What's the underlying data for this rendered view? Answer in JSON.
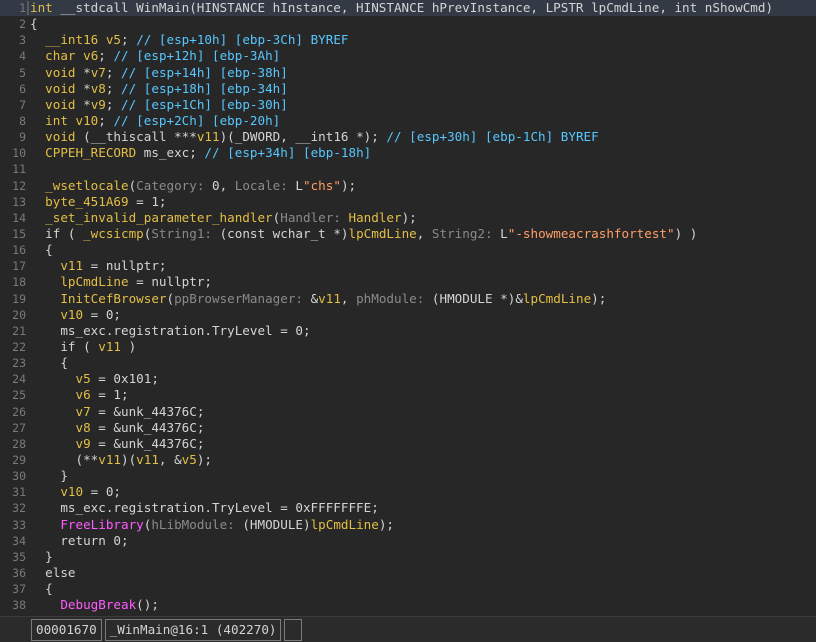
{
  "code_lines": [
    {
      "num": "1",
      "segs": [
        [
          "tp",
          "int"
        ],
        [
          "pl",
          " __stdcall WinMain(HINSTANCE hInstance, HINSTANCE hPrevInstance, LPSTR lpCmdLine, int nShowCmd)"
        ]
      ],
      "active": true
    },
    {
      "num": "2",
      "segs": [
        [
          "pl",
          "{"
        ]
      ]
    },
    {
      "num": "3",
      "segs": [
        [
          "pl",
          "  "
        ],
        [
          "tp",
          "__int16"
        ],
        [
          "pl",
          " "
        ],
        [
          "lv",
          "v5"
        ],
        [
          "pl",
          "; "
        ],
        [
          "cm",
          "// [esp+10h] [ebp-3Ch] BYREF"
        ]
      ]
    },
    {
      "num": "4",
      "segs": [
        [
          "pl",
          "  "
        ],
        [
          "tp",
          "char"
        ],
        [
          "pl",
          " "
        ],
        [
          "lv",
          "v6"
        ],
        [
          "pl",
          "; "
        ],
        [
          "cm",
          "// [esp+12h] [ebp-3Ah]"
        ]
      ]
    },
    {
      "num": "5",
      "segs": [
        [
          "pl",
          "  "
        ],
        [
          "tp",
          "void"
        ],
        [
          "pl",
          " *"
        ],
        [
          "lv",
          "v7"
        ],
        [
          "pl",
          "; "
        ],
        [
          "cm",
          "// [esp+14h] [ebp-38h]"
        ]
      ]
    },
    {
      "num": "6",
      "segs": [
        [
          "pl",
          "  "
        ],
        [
          "tp",
          "void"
        ],
        [
          "pl",
          " *"
        ],
        [
          "lv",
          "v8"
        ],
        [
          "pl",
          "; "
        ],
        [
          "cm",
          "// [esp+18h] [ebp-34h]"
        ]
      ]
    },
    {
      "num": "7",
      "segs": [
        [
          "pl",
          "  "
        ],
        [
          "tp",
          "void"
        ],
        [
          "pl",
          " *"
        ],
        [
          "lv",
          "v9"
        ],
        [
          "pl",
          "; "
        ],
        [
          "cm",
          "// [esp+1Ch] [ebp-30h]"
        ]
      ]
    },
    {
      "num": "8",
      "segs": [
        [
          "pl",
          "  "
        ],
        [
          "tp",
          "int"
        ],
        [
          "pl",
          " "
        ],
        [
          "lv",
          "v10"
        ],
        [
          "pl",
          "; "
        ],
        [
          "cm",
          "// [esp+2Ch] [ebp-20h]"
        ]
      ]
    },
    {
      "num": "9",
      "segs": [
        [
          "pl",
          "  "
        ],
        [
          "tp",
          "void"
        ],
        [
          "pl",
          " (__thiscall ***"
        ],
        [
          "lv",
          "v11"
        ],
        [
          "pl",
          ")(_DWORD, __int16 *); "
        ],
        [
          "cm",
          "// [esp+30h] [ebp-1Ch] BYREF"
        ]
      ]
    },
    {
      "num": "10",
      "segs": [
        [
          "pl",
          "  "
        ],
        [
          "tp",
          "CPPEH_RECORD"
        ],
        [
          "pl",
          " ms_exc; "
        ],
        [
          "cm",
          "// [esp+34h] [ebp-18h]"
        ]
      ]
    },
    {
      "num": "11",
      "segs": []
    },
    {
      "num": "12",
      "segs": [
        [
          "pl",
          "  "
        ],
        [
          "fn",
          "_wsetlocale"
        ],
        [
          "pl",
          "("
        ],
        [
          "hn",
          "Category: "
        ],
        [
          "pl",
          "0, "
        ],
        [
          "hn",
          "Locale: "
        ],
        [
          "pl",
          "L"
        ],
        [
          "st",
          "\"chs\""
        ],
        [
          "pl",
          ");"
        ]
      ]
    },
    {
      "num": "13",
      "segs": [
        [
          "pl",
          "  "
        ],
        [
          "gv",
          "byte_451A69"
        ],
        [
          "pl",
          " = 1;"
        ]
      ]
    },
    {
      "num": "14",
      "segs": [
        [
          "pl",
          "  "
        ],
        [
          "fn",
          "_set_invalid_parameter_handler"
        ],
        [
          "pl",
          "("
        ],
        [
          "hn",
          "Handler: "
        ],
        [
          "fn",
          "Handler"
        ],
        [
          "pl",
          ");"
        ]
      ]
    },
    {
      "num": "15",
      "segs": [
        [
          "pl",
          "  if ( "
        ],
        [
          "fn",
          "_wcsicmp"
        ],
        [
          "pl",
          "("
        ],
        [
          "hn",
          "String1: "
        ],
        [
          "pl",
          "(const wchar_t *)"
        ],
        [
          "lv",
          "lpCmdLine"
        ],
        [
          "pl",
          ", "
        ],
        [
          "hn",
          "String2: "
        ],
        [
          "pl",
          "L"
        ],
        [
          "st",
          "\"-showmeacrashfortest\""
        ],
        [
          "pl",
          ") )"
        ]
      ]
    },
    {
      "num": "16",
      "segs": [
        [
          "pl",
          "  {"
        ]
      ]
    },
    {
      "num": "17",
      "segs": [
        [
          "pl",
          "    "
        ],
        [
          "lv",
          "v11"
        ],
        [
          "pl",
          " = nullptr;"
        ]
      ]
    },
    {
      "num": "18",
      "segs": [
        [
          "pl",
          "    "
        ],
        [
          "lv",
          "lpCmdLine"
        ],
        [
          "pl",
          " = nullptr;"
        ]
      ]
    },
    {
      "num": "19",
      "segs": [
        [
          "pl",
          "    "
        ],
        [
          "fn",
          "InitCefBrowser"
        ],
        [
          "pl",
          "("
        ],
        [
          "hn",
          "ppBrowserManager: "
        ],
        [
          "pl",
          "&"
        ],
        [
          "lv",
          "v11"
        ],
        [
          "pl",
          ", "
        ],
        [
          "hn",
          "phModule: "
        ],
        [
          "pl",
          "(HMODULE *)&"
        ],
        [
          "lv",
          "lpCmdLine"
        ],
        [
          "pl",
          ");"
        ]
      ]
    },
    {
      "num": "20",
      "segs": [
        [
          "pl",
          "    "
        ],
        [
          "lv",
          "v10"
        ],
        [
          "pl",
          " = 0;"
        ]
      ]
    },
    {
      "num": "21",
      "segs": [
        [
          "pl",
          "    ms_exc.registration.TryLevel = 0;"
        ]
      ]
    },
    {
      "num": "22",
      "segs": [
        [
          "pl",
          "    if ( "
        ],
        [
          "lv",
          "v11"
        ],
        [
          "pl",
          " )"
        ]
      ]
    },
    {
      "num": "23",
      "segs": [
        [
          "pl",
          "    {"
        ]
      ]
    },
    {
      "num": "24",
      "segs": [
        [
          "pl",
          "      "
        ],
        [
          "lv",
          "v5"
        ],
        [
          "pl",
          " = 0x101;"
        ]
      ]
    },
    {
      "num": "25",
      "segs": [
        [
          "pl",
          "      "
        ],
        [
          "lv",
          "v6"
        ],
        [
          "pl",
          " = 1;"
        ]
      ]
    },
    {
      "num": "26",
      "segs": [
        [
          "pl",
          "      "
        ],
        [
          "lv",
          "v7"
        ],
        [
          "pl",
          " = &unk_44376C;"
        ]
      ]
    },
    {
      "num": "27",
      "segs": [
        [
          "pl",
          "      "
        ],
        [
          "lv",
          "v8"
        ],
        [
          "pl",
          " = &unk_44376C;"
        ]
      ]
    },
    {
      "num": "28",
      "segs": [
        [
          "pl",
          "      "
        ],
        [
          "lv",
          "v9"
        ],
        [
          "pl",
          " = &unk_44376C;"
        ]
      ]
    },
    {
      "num": "29",
      "segs": [
        [
          "pl",
          "      (**"
        ],
        [
          "lv",
          "v11"
        ],
        [
          "pl",
          ")("
        ],
        [
          "lv",
          "v11"
        ],
        [
          "pl",
          ", &"
        ],
        [
          "lv",
          "v5"
        ],
        [
          "pl",
          ");"
        ]
      ]
    },
    {
      "num": "30",
      "segs": [
        [
          "pl",
          "    }"
        ]
      ]
    },
    {
      "num": "31",
      "segs": [
        [
          "pl",
          "    "
        ],
        [
          "lv",
          "v10"
        ],
        [
          "pl",
          " = 0;"
        ]
      ]
    },
    {
      "num": "32",
      "segs": [
        [
          "pl",
          "    ms_exc.registration.TryLevel = 0xFFFFFFFE;"
        ]
      ]
    },
    {
      "num": "33",
      "segs": [
        [
          "pl",
          "    "
        ],
        [
          "im",
          "FreeLibrary"
        ],
        [
          "pl",
          "("
        ],
        [
          "hn",
          "hLibModule: "
        ],
        [
          "pl",
          "(HMODULE)"
        ],
        [
          "lv",
          "lpCmdLine"
        ],
        [
          "pl",
          ");"
        ]
      ]
    },
    {
      "num": "34",
      "segs": [
        [
          "pl",
          "    return 0;"
        ]
      ]
    },
    {
      "num": "35",
      "segs": [
        [
          "pl",
          "  }"
        ]
      ]
    },
    {
      "num": "36",
      "segs": [
        [
          "pl",
          "  else"
        ]
      ]
    },
    {
      "num": "37",
      "segs": [
        [
          "pl",
          "  {"
        ]
      ]
    },
    {
      "num": "38",
      "segs": [
        [
          "pl",
          "    "
        ],
        [
          "im",
          "DebugBreak"
        ],
        [
          "pl",
          "();"
        ]
      ]
    }
  ],
  "status_bar": {
    "address": "00001670",
    "location": "_WinMain@16:1 (402270)",
    "extra": ""
  },
  "colors": {
    "background": "#272727",
    "comment": "#57c7ff",
    "identifier": "#e3bf45",
    "import": "#ff5cff",
    "hint": "#8a8a8a",
    "string": "#ff9e66"
  }
}
